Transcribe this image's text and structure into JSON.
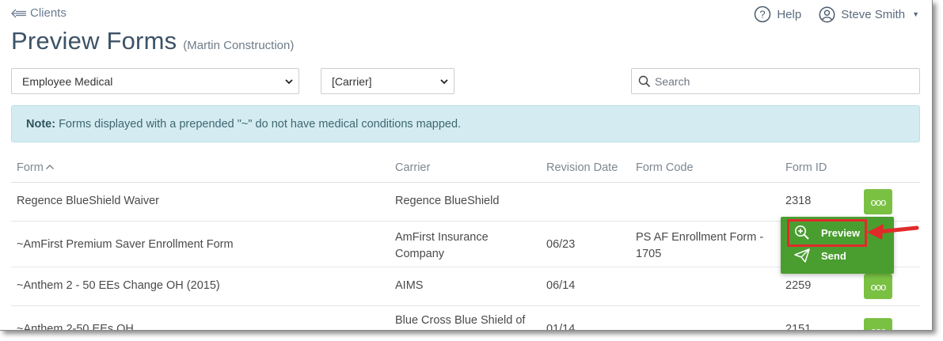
{
  "nav": {
    "back_label": "Clients",
    "help_label": "Help",
    "user_name": "Steve Smith"
  },
  "page": {
    "title": "Preview Forms",
    "subtitle": "(Martin Construction)"
  },
  "filters": {
    "coverage_value": "Employee Medical",
    "carrier_value": "[Carrier]",
    "search_placeholder": "Search"
  },
  "note": {
    "prefix": "Note:",
    "text": "Forms displayed with a prepended \"~\" do not have medical conditions mapped."
  },
  "table": {
    "columns": [
      "Form",
      "Carrier",
      "Revision Date",
      "Form Code",
      "Form ID"
    ],
    "rows": [
      {
        "form": "Regence BlueShield Waiver",
        "carrier": "Regence BlueShield",
        "carrier2": "",
        "revision": "",
        "code": "",
        "code2": "",
        "id": "2318"
      },
      {
        "form": "~AmFirst Premium Saver Enrollment Form",
        "carrier": "AmFirst Insurance",
        "carrier2": "Company",
        "revision": "06/23",
        "code": "PS AF Enrollment Form -",
        "code2": "1705",
        "id": ""
      },
      {
        "form": "~Anthem 2 - 50 EEs Change OH (2015)",
        "carrier": "AIMS",
        "carrier2": "",
        "revision": "06/14",
        "code": "",
        "code2": "",
        "id": "2259"
      },
      {
        "form": "~Anthem 2-50 EEs OH",
        "carrier": "Blue Cross Blue Shield of",
        "carrier2": "",
        "revision": "01/14",
        "code": "",
        "code2": "",
        "id": "2151"
      }
    ]
  },
  "action_menu": {
    "preview_label": "Preview",
    "send_label": "Send",
    "more_glyph": "ooo"
  },
  "colors": {
    "accent_green": "#7ac143",
    "menu_green": "#4a9e2f",
    "highlight_red": "#e02b2b",
    "note_bg": "#d4ecf1"
  }
}
